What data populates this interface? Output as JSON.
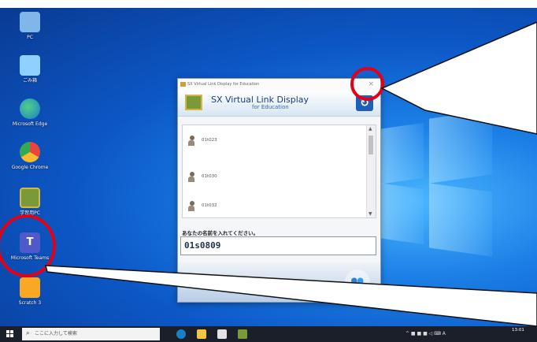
{
  "desktop": {
    "icons": [
      {
        "label": "PC",
        "icon": "computer-icon",
        "color": "#7fb7e8"
      },
      {
        "label": "ごみ箱",
        "icon": "recycle-bin-icon",
        "color": "#8fd0ff"
      },
      {
        "label": "Microsoft Edge",
        "icon": "edge-icon",
        "color": "#2a9d6b"
      },
      {
        "label": "Google Chrome",
        "icon": "chrome-icon",
        "color": "#e8453c"
      },
      {
        "label": "学習用PC",
        "icon": "sx-display-icon",
        "color": "#7a9a3a"
      },
      {
        "label": "Microsoft Teams",
        "icon": "teams-icon",
        "color": "#5059c9"
      },
      {
        "label": "Scratch 3",
        "icon": "scratch-icon",
        "color": "#f9a825"
      }
    ]
  },
  "dialog": {
    "window_title": "SX Virtual Link Display for Education",
    "close_glyph": "×",
    "app_title": "SX Virtual Link Display",
    "app_subtitle": "for Education",
    "refresh_glyph": "↻",
    "devices": [
      {
        "name": "01t023"
      },
      {
        "name": "01t030"
      },
      {
        "name": "01t032"
      }
    ],
    "name_prompt": "あなたの名前を入れてください。",
    "name_value": "01s0809"
  },
  "taskbar": {
    "search_placeholder": "ここに入力して検索",
    "tray_text": "^ ■ ■ ■ ◁ ⌨ A",
    "time": "13:01"
  },
  "colors": {
    "annotation_red": "#e40015",
    "desktop_blue": "#1b7fe6"
  }
}
